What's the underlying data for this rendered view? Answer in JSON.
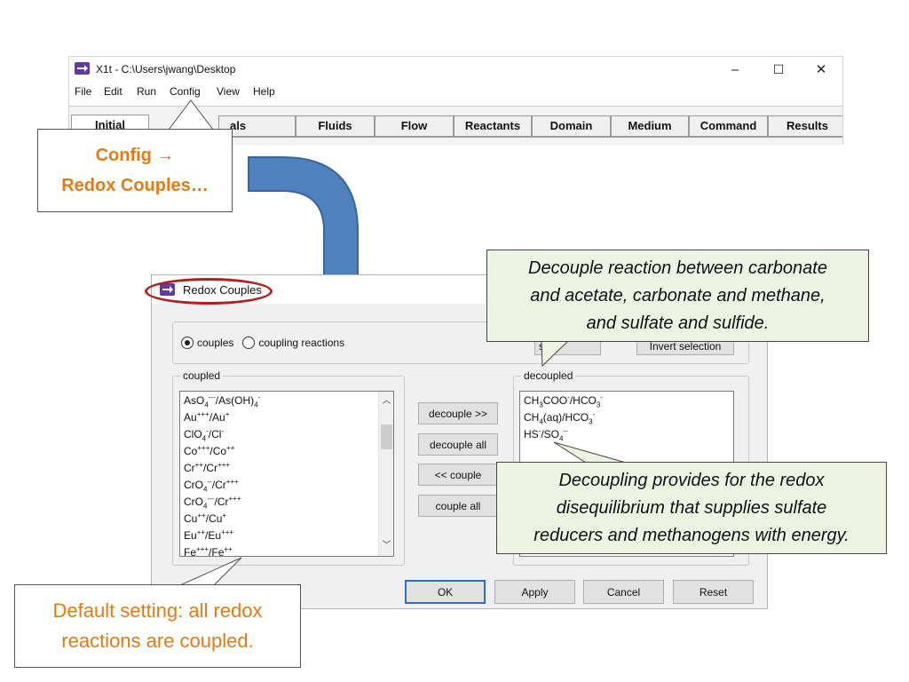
{
  "app_window": {
    "title": "X1t - C:\\Users\\jwang\\Desktop",
    "controls": {
      "minimize": "–",
      "maximize": "☐",
      "close": "✕"
    },
    "menu": [
      "File",
      "Edit",
      "Run",
      "Config",
      "View",
      "Help"
    ],
    "tabs": [
      "Initial",
      "als",
      "Fluids",
      "Flow",
      "Reactants",
      "Domain",
      "Medium",
      "Command",
      "Results"
    ],
    "active_tab": "Initial"
  },
  "callouts": {
    "config_line1": "Config →",
    "config_line2": "Redox Couples…",
    "default_line1": "Default setting: all redox",
    "default_line2": "reactions are coupled.",
    "decouple_line1": "Decouple reaction between carbonate",
    "decouple_line2": "and acetate, carbonate and methane,",
    "decouple_line3": "and sulfate and sulfide.",
    "decoupling_line1": "Decoupling provides for the redox",
    "decoupling_line2": "disequilibrium that supplies sulfate",
    "decoupling_line3": "reducers and methanogens with energy."
  },
  "dialog": {
    "title": "Redox Couples",
    "radio_couples": "couples",
    "radio_coupling_reactions": "coupling reactions",
    "selected_radio": "couples",
    "partial_select_button": "se",
    "invert_selection_button": "Invert selection",
    "coupled_label": "coupled",
    "decoupled_label": "decoupled",
    "coupled_items": [
      {
        "a": "AsO",
        "a_sub": "4",
        "a_sup": "---",
        "b": "/As(OH)",
        "b_sub": "4",
        "b_sup": "-"
      },
      {
        "a": "Au",
        "a_sub": "",
        "a_sup": "+++",
        "b": "/Au",
        "b_sub": "",
        "b_sup": "+"
      },
      {
        "a": "ClO",
        "a_sub": "4",
        "a_sup": "-",
        "b": "/Cl",
        "b_sub": "",
        "b_sup": "-"
      },
      {
        "a": "Co",
        "a_sub": "",
        "a_sup": "+++",
        "b": "/Co",
        "b_sub": "",
        "b_sup": "++"
      },
      {
        "a": "Cr",
        "a_sub": "",
        "a_sup": "++",
        "b": "/Cr",
        "b_sub": "",
        "b_sup": "+++"
      },
      {
        "a": "CrO",
        "a_sub": "4",
        "a_sup": "--",
        "b": "/Cr",
        "b_sub": "",
        "b_sup": "+++"
      },
      {
        "a": "CrO",
        "a_sub": "4",
        "a_sup": "---",
        "b": "/Cr",
        "b_sub": "",
        "b_sup": "+++"
      },
      {
        "a": "Cu",
        "a_sub": "",
        "a_sup": "++",
        "b": "/Cu",
        "b_sub": "",
        "b_sup": "+"
      },
      {
        "a": "Eu",
        "a_sub": "",
        "a_sup": "++",
        "b": "/Eu",
        "b_sub": "",
        "b_sup": "+++"
      },
      {
        "a": "Fe",
        "a_sub": "",
        "a_sup": "+++",
        "b": "/Fe",
        "b_sub": "",
        "b_sup": "++"
      }
    ],
    "decoupled_items": [
      {
        "a": "CH",
        "a_sub": "3",
        "a_mid": "COO",
        "a_sup": "-",
        "b": "/HCO",
        "b_sub": "3",
        "b_sup": "-"
      },
      {
        "a": "CH",
        "a_sub": "4",
        "a_mid": "(aq)",
        "a_sup": "",
        "b": "/HCO",
        "b_sub": "3",
        "b_sup": "-"
      },
      {
        "a": "HS",
        "a_sub": "",
        "a_mid": "",
        "a_sup": "-",
        "b": "/SO",
        "b_sub": "4",
        "b_sup": "--"
      }
    ],
    "buttons": {
      "decouple": "decouple >>",
      "decouple_all": "decouple all",
      "couple": "<< couple",
      "couple_all": "couple all",
      "ok": "OK",
      "apply": "Apply",
      "cancel": "Cancel",
      "reset": "Reset"
    },
    "scroll_up": "︿",
    "scroll_down": "﹀"
  },
  "colors": {
    "callout_orange": "#e07b16",
    "green_callout_bg": "#eef4e4",
    "arrow_blue": "#4f81bd",
    "highlight_red": "#b01e1e"
  }
}
